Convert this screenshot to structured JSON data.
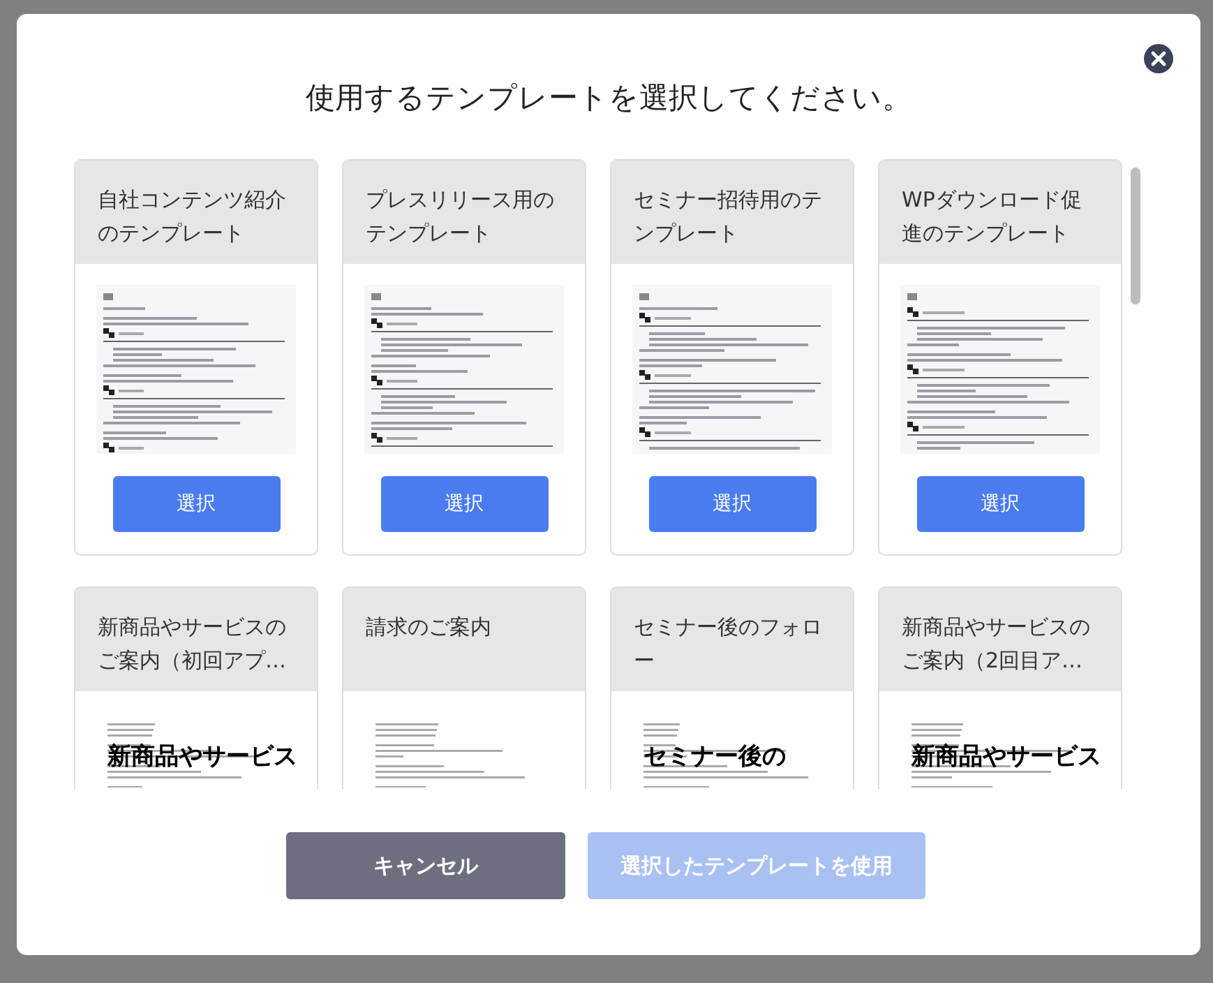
{
  "dialog": {
    "title": "使用するテンプレートを選択してください。"
  },
  "templates": [
    {
      "title": "自社コンテンツ紹介のテンプレート",
      "kind": "document",
      "button": "選択"
    },
    {
      "title": "プレスリリース用のテンプレート",
      "kind": "document",
      "button": "選択"
    },
    {
      "title": "セミナー招待用のテンプレート",
      "kind": "document",
      "button": "選択"
    },
    {
      "title": "WPダウンロード促進のテンプレート",
      "kind": "document",
      "button": "選択"
    },
    {
      "title": "新商品やサービスのご案内（初回アプ…",
      "kind": "email",
      "headline": "新商品やサービス"
    },
    {
      "title": "請求のご案内",
      "kind": "email"
    },
    {
      "title": "セミナー後のフォロー",
      "kind": "email",
      "headline": "セミナー後の"
    },
    {
      "title": "新商品やサービスのご案内（2回目ア…",
      "kind": "email",
      "headline": "新商品やサービス"
    }
  ],
  "footer": {
    "cancel": "キャンセル",
    "confirm": {
      "label": "選択したテンプレートを使用",
      "disabled": true
    }
  }
}
